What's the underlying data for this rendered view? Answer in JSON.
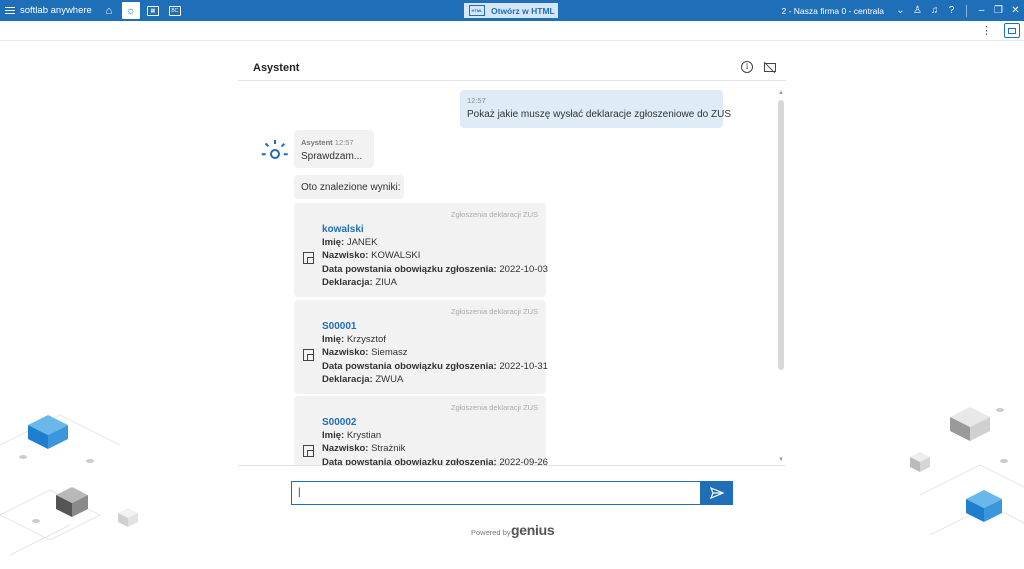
{
  "topbar": {
    "app_name": "softlab anywhere",
    "open_html_label": "Otwórz w HTML",
    "doc_icon_text": "HTML",
    "company": "2 - Nasza firma 0 - centrala",
    "icons": [
      "menu-icon",
      "home-icon",
      "lightbulb-icon",
      "calendar-icon",
      "bc-icon",
      "user-icon",
      "bell-icon",
      "help-icon",
      "minimize-icon",
      "restore-icon",
      "close-icon"
    ],
    "accent": "#1f6fb8"
  },
  "panel": {
    "title": "Asystent"
  },
  "messages": {
    "user": {
      "time": "12:57",
      "text": "Pokaż jakie muszę wysłać deklaracje zgłoszeniowe do ZUS"
    },
    "bot": {
      "sender": "Asystent",
      "time": "12:57",
      "text": "Sprawdzam..."
    },
    "results_intro": "Oto znalezione wyniki:"
  },
  "results": [
    {
      "source": "Zgłoszenia deklaracji ZUS",
      "name": "kowalski",
      "imie_label": "Imię:",
      "imie": "JANEK",
      "nazwisko_label": "Nazwisko:",
      "nazwisko": "KOWALSKI",
      "data_label": "Data powstania obowiązku zgłoszenia:",
      "data": "2022-10-03",
      "deklaracja_label": "Deklaracja:",
      "deklaracja": "ZIUA"
    },
    {
      "source": "Zgłoszenia deklaracji ZUS",
      "name": "S00001",
      "imie_label": "Imię:",
      "imie": "Krzysztof",
      "nazwisko_label": "Nazwisko:",
      "nazwisko": "Siemasz",
      "data_label": "Data powstania obowiązku zgłoszenia:",
      "data": "2022-10-31",
      "deklaracja_label": "Deklaracja:",
      "deklaracja": "ZWUA"
    },
    {
      "source": "Zgłoszenia deklaracji ZUS",
      "name": "S00002",
      "imie_label": "Imię:",
      "imie": "Krystian",
      "nazwisko_label": "Nazwisko:",
      "nazwisko": "Strażnik",
      "data_label": "Data powstania obowiązku zgłoszenia:",
      "data": "2022-09-26",
      "deklaracja_label": "Deklaracja:",
      "deklaracja": ""
    }
  ],
  "composer": {
    "value": "|",
    "powered_by": "Powered by",
    "logo": "genius"
  }
}
